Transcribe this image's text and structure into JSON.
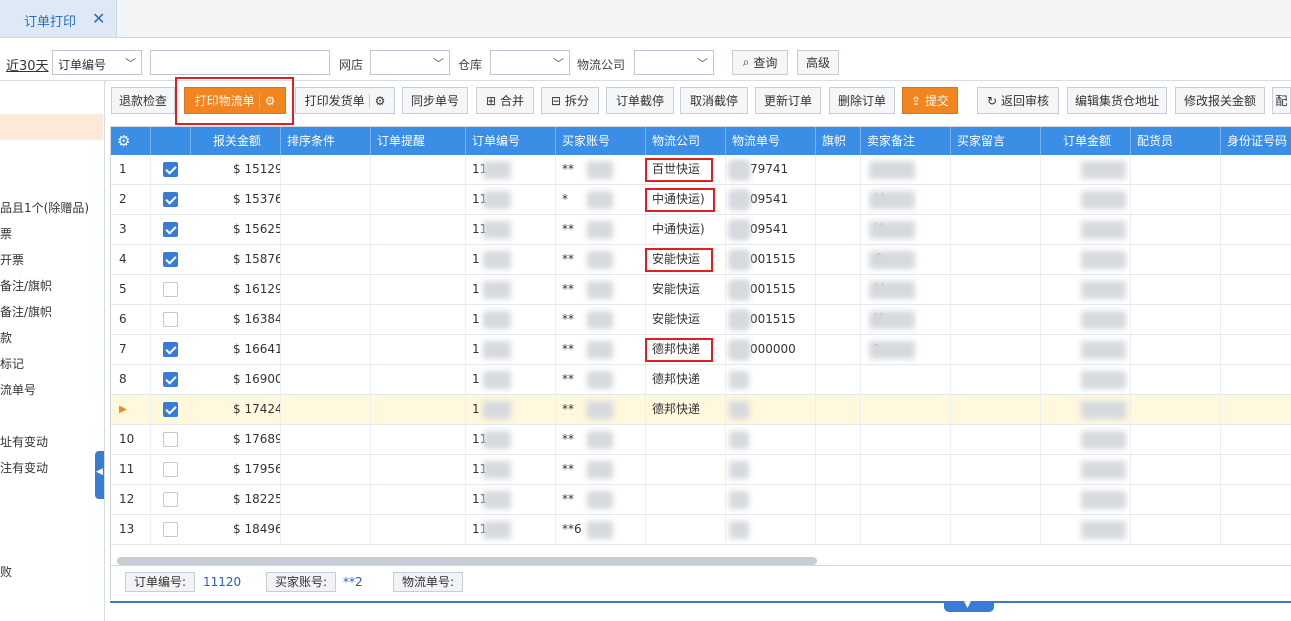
{
  "tab": {
    "title": "订单打印",
    "close": "✕"
  },
  "filter": {
    "range_link": "近30天",
    "field_select": "订单编号",
    "search_value": "",
    "shop_label": "网店",
    "warehouse_label": "仓库",
    "logistics_label": "物流公司",
    "query_button": "查询",
    "advanced_button": "高级"
  },
  "sidebar": {
    "items": [
      "品且1个(除赠品)",
      "票",
      "开票",
      "备注/旗帜",
      "备注/旗帜",
      "款",
      "标记",
      "流单号",
      "址有变动",
      "注有变动",
      "败"
    ]
  },
  "toolbar": {
    "refund_check": "退款检查",
    "print_waybill": "打印物流单",
    "print_invoice": "打印发货单",
    "sync_no": "同步单号",
    "merge": "合并",
    "split": "拆分",
    "intercept": "订单截停",
    "cancel_intercept": "取消截停",
    "update_order": "更新订单",
    "delete_order": "删除订单",
    "submit": "提交",
    "return_review": "返回审核",
    "edit_address": "编辑集货仓地址",
    "edit_customs": "修改报关金额",
    "more": "配"
  },
  "grid": {
    "columns": [
      "报关金额",
      "排序条件",
      "订单提醒",
      "订单编号",
      "买家账号",
      "物流公司",
      "物流单号",
      "旗帜",
      "卖家备注",
      "买家留言",
      "订单金额",
      "配货员",
      "身份证号码"
    ],
    "rows": [
      {
        "no": "1",
        "checked": true,
        "amount": "$ 15129",
        "order": "11",
        "buyer": "**",
        "company": "百世快运",
        "waybill": "79741",
        "remark": ""
      },
      {
        "no": "2",
        "checked": true,
        "amount": "$ 15376",
        "order": "11",
        "buyer": "*",
        "company": "中通快运)",
        "waybill": "09541",
        "remark": "付"
      },
      {
        "no": "3",
        "checked": true,
        "amount": "$ 15625",
        "order": "11",
        "buyer": "**",
        "company": "中通快运)",
        "waybill": "09541",
        "remark": "结"
      },
      {
        "no": "4",
        "checked": true,
        "amount": "$ 15876",
        "order": "1",
        "buyer": "**",
        "company": "安能快运",
        "waybill": "001515",
        "remark": "金"
      },
      {
        "no": "5",
        "checked": false,
        "amount": "$ 16129",
        "order": "1",
        "buyer": "**",
        "company": "安能快运",
        "waybill": "001515",
        "remark": "付"
      },
      {
        "no": "6",
        "checked": false,
        "amount": "$ 16384",
        "order": "1",
        "buyer": "**",
        "company": "安能快运",
        "waybill": "001515",
        "remark": "结"
      },
      {
        "no": "7",
        "checked": true,
        "amount": "$ 16641",
        "order": "1",
        "buyer": "**",
        "company": "德邦快递",
        "waybill": "000000",
        "remark": "2"
      },
      {
        "no": "8",
        "checked": true,
        "amount": "$ 16900",
        "order": "1",
        "buyer": "**",
        "company": "德邦快递",
        "waybill": "",
        "remark": ""
      },
      {
        "no": "▶",
        "checked": true,
        "amount": "$ 17424",
        "order": "1",
        "buyer": "**",
        "company": "德邦快递",
        "waybill": "",
        "remark": ""
      },
      {
        "no": "10",
        "checked": false,
        "amount": "$ 17689",
        "order": "11",
        "buyer": "**",
        "company": "",
        "waybill": "",
        "remark": ""
      },
      {
        "no": "11",
        "checked": false,
        "amount": "$ 17956",
        "order": "11",
        "buyer": "**",
        "company": "",
        "waybill": "",
        "remark": ""
      },
      {
        "no": "12",
        "checked": false,
        "amount": "$ 18225",
        "order": "11",
        "buyer": "**",
        "company": "",
        "waybill": "",
        "remark": ""
      },
      {
        "no": "13",
        "checked": false,
        "amount": "$ 18496",
        "order": "11",
        "buyer": "**6",
        "company": "",
        "waybill": "",
        "remark": ""
      }
    ]
  },
  "status": {
    "order_label": "订单编号:",
    "order_value": "11120",
    "buyer_label": "买家账号:",
    "buyer_value": "**2",
    "waybill_label": "物流单号:"
  },
  "colors": {
    "accent": "#3a8ee6",
    "orange": "#f08522",
    "highlight_red": "#e02020"
  }
}
